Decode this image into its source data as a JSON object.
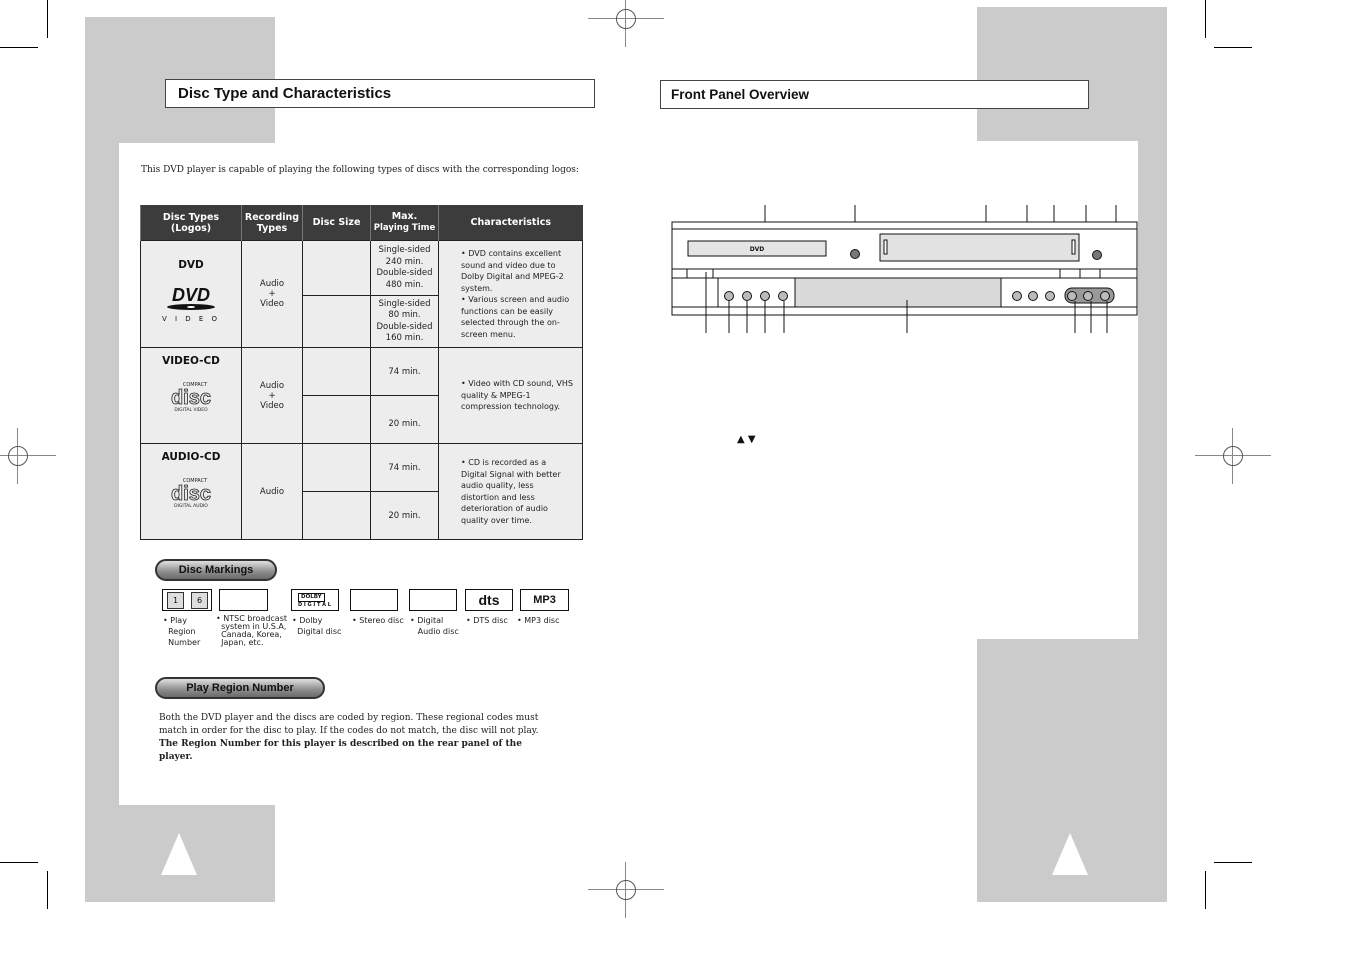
{
  "left_page": {
    "title": "Disc Type and Characteristics",
    "intro": "This DVD player is capable of playing the following types of discs with the corresponding logos:",
    "table": {
      "headers": [
        "Disc Types (Logos)",
        "Recording Types",
        "Disc Size",
        "Max. Playing Time",
        "Characteristics"
      ],
      "header_lines": {
        "disc_types": [
          "Disc Types",
          "(Logos)"
        ],
        "recording_types": [
          "Recording",
          "Types"
        ],
        "disc_size": "Disc Size",
        "max_time": [
          "Max.",
          "Playing Time"
        ],
        "characteristics": "Characteristics"
      },
      "rows": [
        {
          "type": "DVD",
          "logo": "dvd-video-logo",
          "logo_caption": "V I D E O",
          "recording": [
            "Audio",
            "+",
            "Video"
          ],
          "sizes": [
            "",
            ""
          ],
          "times": [
            [
              "Single-sided",
              "240 min.",
              "Double-sided",
              "480 min."
            ],
            [
              "Single-sided",
              "80 min.",
              "Double-sided",
              "160 min."
            ]
          ],
          "characteristics": [
            "DVD contains excellent sound and video due to Dolby Digital and MPEG-2 system.",
            "Various screen and audio functions can be easily selected through the on-screen menu."
          ]
        },
        {
          "type": "VIDEO-CD",
          "logo": "compact-disc-digital-video-logo",
          "logo_caption_top": "COMPACT",
          "logo_caption": "DIGITAL VIDEO",
          "recording": [
            "Audio",
            "+",
            "Video"
          ],
          "sizes": [
            "",
            ""
          ],
          "times": [
            [
              "74 min."
            ],
            [
              "20 min."
            ]
          ],
          "characteristics": [
            "Video with CD sound, VHS quality & MPEG-1 compression technology."
          ]
        },
        {
          "type": "AUDIO-CD",
          "logo": "compact-disc-digital-audio-logo",
          "logo_caption_top": "COMPACT",
          "logo_caption": "DIGITAL AUDIO",
          "recording": [
            "Audio"
          ],
          "sizes": [
            "",
            ""
          ],
          "times": [
            [
              "74 min."
            ],
            [
              "20 min."
            ]
          ],
          "characteristics": [
            "CD is recorded as a Digital Signal with better audio quality, less distortion and less deterioration of audio quality over time."
          ]
        }
      ]
    },
    "disc_markings": {
      "heading": "Disc Markings",
      "items": [
        {
          "icon": "region-number-icon",
          "label": [
            "• Play",
            "Region",
            "Number"
          ],
          "glyphs": [
            "1",
            "6"
          ]
        },
        {
          "icon": "ntsc-icon",
          "label": [
            "• NTSC broadcast",
            "system in U.S.A,",
            "Canada, Korea,",
            "Japan, etc."
          ]
        },
        {
          "icon": "dolby-digital-icon",
          "label": [
            "• Dolby",
            "Digital disc"
          ],
          "glyphs": [
            "DOLBY",
            "D I G I T A L"
          ]
        },
        {
          "icon": "stereo-icon",
          "label": [
            "• Stereo disc"
          ]
        },
        {
          "icon": "digital-audio-icon",
          "label": [
            "• Digital",
            "Audio disc"
          ]
        },
        {
          "icon": "dts-icon",
          "label": [
            "• DTS disc"
          ],
          "glyphs": [
            "dts"
          ]
        },
        {
          "icon": "mp3-icon",
          "label": [
            "• MP3 disc"
          ],
          "glyphs": [
            "MP3"
          ]
        }
      ]
    },
    "play_region": {
      "heading": "Play Region Number",
      "body": "Both the DVD player and the discs are coded by region. These regional codes must match in order for the disc to play. If the codes do not match, the disc will not play.",
      "bold": "The Region Number for this player is described on the rear panel of the player."
    }
  },
  "right_page": {
    "title": "Front Panel Overview",
    "arrows_text": "▲ ▼"
  },
  "colors": {
    "sidebar_gray": "#cbcbcb",
    "table_header": "#3c3c3c",
    "table_cell": "#ededed"
  }
}
